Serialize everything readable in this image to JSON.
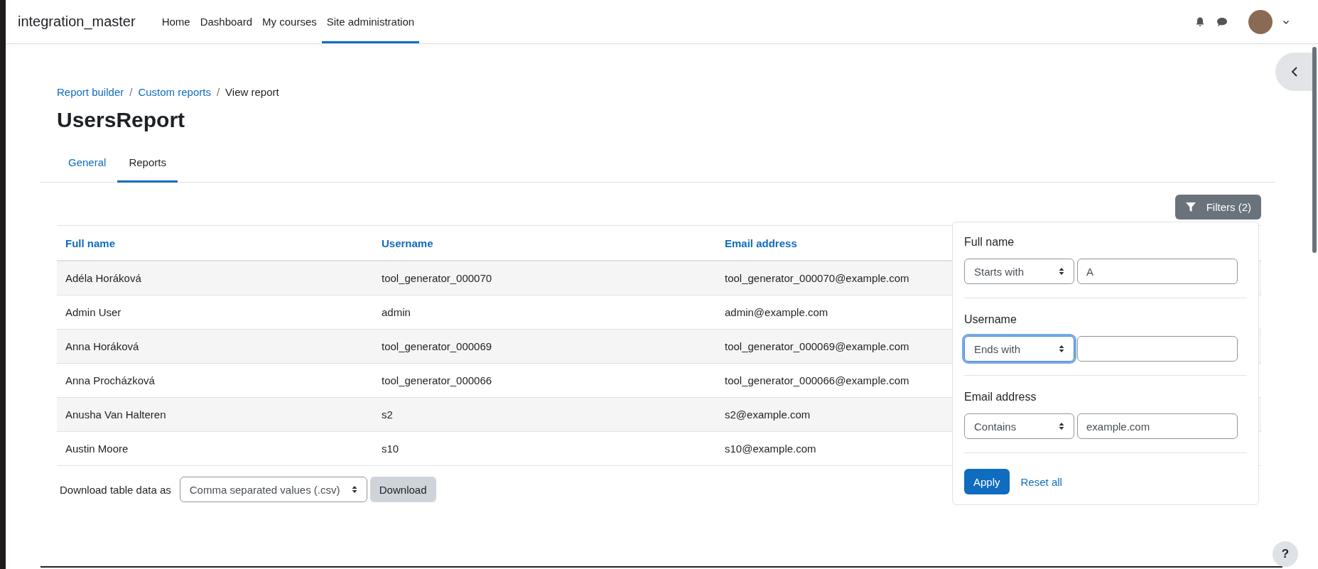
{
  "navbar": {
    "site_name": "integration_master",
    "items": [
      {
        "label": "Home",
        "selected": false
      },
      {
        "label": "Dashboard",
        "selected": false
      },
      {
        "label": "My courses",
        "selected": false
      },
      {
        "label": "Site administration",
        "selected": true
      }
    ]
  },
  "breadcrumb": [
    {
      "label": "Report builder",
      "kind": "link"
    },
    {
      "separator_before": "/",
      "label": "Custom reports",
      "kind": "link"
    },
    {
      "separator_before": "/",
      "label": "View report",
      "kind": "current"
    }
  ],
  "page_title": "UsersReport",
  "tabs": [
    {
      "label": "General",
      "selected": false
    },
    {
      "label": "Reports",
      "selected": true
    }
  ],
  "filters_button": "Filters (2)",
  "table": {
    "columns": [
      "Full name",
      "Username",
      "Email address"
    ],
    "rows": [
      [
        "Adéla Horáková",
        "tool_generator_000070",
        "tool_generator_000070@example.com"
      ],
      [
        "Admin User",
        "admin",
        "admin@example.com"
      ],
      [
        "Anna Horáková",
        "tool_generator_000069",
        "tool_generator_000069@example.com"
      ],
      [
        "Anna Procházková",
        "tool_generator_000066",
        "tool_generator_000066@example.com"
      ],
      [
        "Anusha Van Halteren",
        "s2",
        "s2@example.com"
      ],
      [
        "Austin Moore",
        "s10",
        "s10@example.com"
      ]
    ]
  },
  "download": {
    "label": "Download table data as",
    "format": "Comma separated values (.csv)",
    "button": "Download"
  },
  "filters_panel": {
    "filters": [
      {
        "label": "Full name",
        "operator": "Starts with",
        "value": "A",
        "focused": false
      },
      {
        "label": "Username",
        "operator": "Ends with",
        "focused": true
      },
      {
        "label": "Email address",
        "operator": "Contains",
        "value": "example.com",
        "focused": false
      }
    ],
    "apply": "Apply",
    "reset": "Reset all"
  },
  "help_button": "?"
}
